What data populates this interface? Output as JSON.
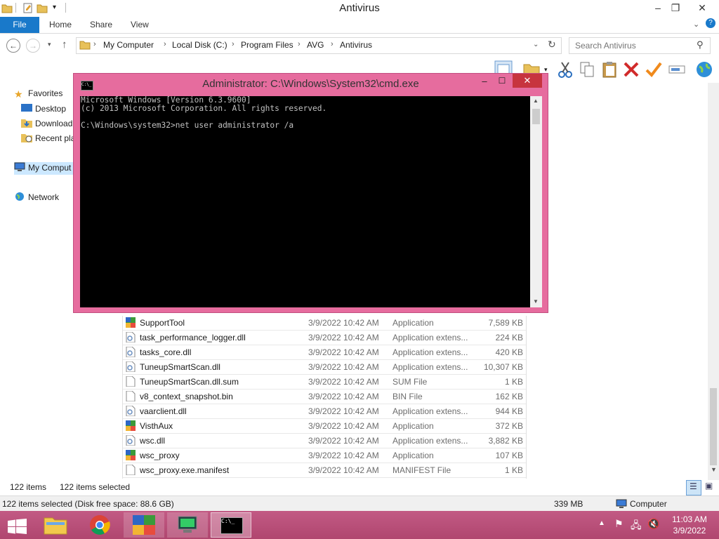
{
  "explorer": {
    "title": "Antivirus",
    "tabs": {
      "file": "File",
      "home": "Home",
      "share": "Share",
      "view": "View"
    },
    "breadcrumb": [
      "My Computer",
      "Local Disk (C:)",
      "Program Files",
      "AVG",
      "Antivirus"
    ],
    "search_placeholder": "Search Antivirus",
    "nav": {
      "favorites": "Favorites",
      "desktop": "Desktop",
      "downloads": "Download",
      "recent": "Recent pla",
      "computer": "My Comput",
      "network": "Network"
    },
    "files": [
      {
        "name": "SupportTool",
        "date": "3/9/2022 10:42 AM",
        "type": "Application",
        "size": "7,589 KB",
        "icon": "avg-app-icon"
      },
      {
        "name": "task_performance_logger.dll",
        "date": "3/9/2022 10:42 AM",
        "type": "Application extens...",
        "size": "224 KB",
        "icon": "dll-icon"
      },
      {
        "name": "tasks_core.dll",
        "date": "3/9/2022 10:42 AM",
        "type": "Application extens...",
        "size": "420 KB",
        "icon": "dll-icon"
      },
      {
        "name": "TuneupSmartScan.dll",
        "date": "3/9/2022 10:42 AM",
        "type": "Application extens...",
        "size": "10,307 KB",
        "icon": "dll-icon"
      },
      {
        "name": "TuneupSmartScan.dll.sum",
        "date": "3/9/2022 10:42 AM",
        "type": "SUM File",
        "size": "1 KB",
        "icon": "file-icon"
      },
      {
        "name": "v8_context_snapshot.bin",
        "date": "3/9/2022 10:42 AM",
        "type": "BIN File",
        "size": "162 KB",
        "icon": "file-icon"
      },
      {
        "name": "vaarclient.dll",
        "date": "3/9/2022 10:42 AM",
        "type": "Application extens...",
        "size": "944 KB",
        "icon": "dll-icon"
      },
      {
        "name": "VisthAux",
        "date": "3/9/2022 10:42 AM",
        "type": "Application",
        "size": "372 KB",
        "icon": "avg-app-icon"
      },
      {
        "name": "wsc.dll",
        "date": "3/9/2022 10:42 AM",
        "type": "Application extens...",
        "size": "3,882 KB",
        "icon": "dll-icon"
      },
      {
        "name": "wsc_proxy",
        "date": "3/9/2022 10:42 AM",
        "type": "Application",
        "size": "107 KB",
        "icon": "avg-app-icon"
      },
      {
        "name": "wsc_proxy.exe.manifest",
        "date": "3/9/2022 10:42 AM",
        "type": "MANIFEST File",
        "size": "1 KB",
        "icon": "file-icon"
      }
    ],
    "status": {
      "count": "122 items",
      "selected": "122 items selected"
    },
    "details": {
      "left": "122 items selected (Disk free space: 88.6 GB)",
      "size": "339 MB",
      "location": "Computer"
    }
  },
  "cmd": {
    "title": "Administrator: C:\\Windows\\System32\\cmd.exe",
    "icon_text": "C:\\_",
    "lines": "Microsoft Windows [Version 6.3.9600]\n(c) 2013 Microsoft Corporation. All rights reserved.\n\nC:\\Windows\\system32>net user administrator /a"
  },
  "taskbar": {
    "time": "11:03 AM",
    "date": "3/9/2022",
    "apps": [
      "start-button",
      "file-explorer-app",
      "chrome-app",
      "avg-app",
      "remote-desktop-app",
      "cmd-app"
    ]
  },
  "colors": {
    "accent": "#1979ca",
    "taskbar": "#b0466f",
    "cmd_frame": "#e66c9e"
  }
}
